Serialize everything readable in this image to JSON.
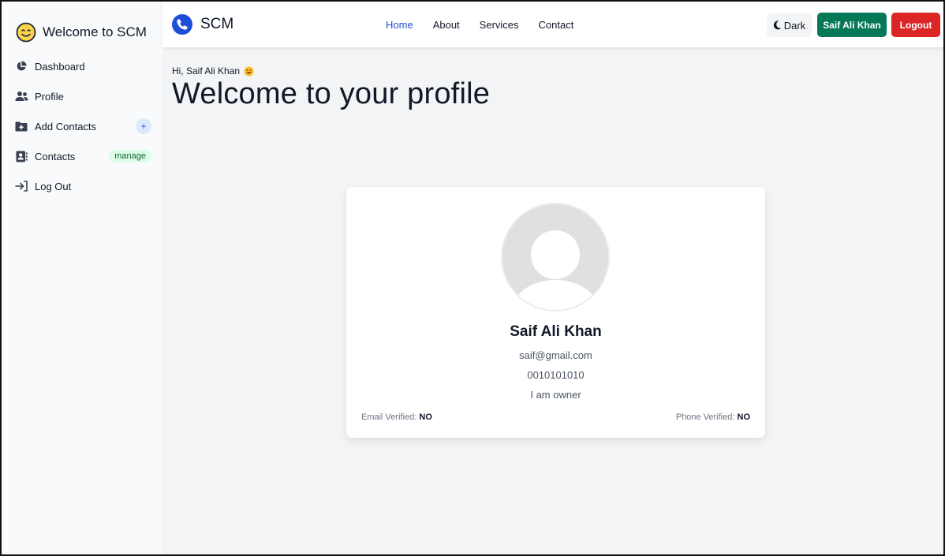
{
  "sidebar": {
    "brand": "Welcome to SCM",
    "items": [
      {
        "label": "Dashboard",
        "icon": "chart-pie-icon"
      },
      {
        "label": "Profile",
        "icon": "users-icon"
      },
      {
        "label": "Add Contacts",
        "icon": "folder-plus-icon",
        "badge": "+"
      },
      {
        "label": "Contacts",
        "icon": "address-book-icon",
        "badge": "manage"
      },
      {
        "label": "Log Out",
        "icon": "sign-out-icon"
      }
    ]
  },
  "navbar": {
    "logo_text": "SCM",
    "links": [
      "Home",
      "About",
      "Services",
      "Contact"
    ],
    "active_link": "Home",
    "dark_label": "Dark",
    "user_label": "Saif Ali Khan",
    "logout_label": "Logout"
  },
  "main": {
    "greeting": "Hi, Saif Ali Khan",
    "title": "Welcome to your profile"
  },
  "profile": {
    "name": "Saif Ali Khan",
    "email": "saif@gmail.com",
    "phone": "0010101010",
    "about": "I am owner",
    "email_verified_label": "Email Verified:",
    "email_verified_value": "NO",
    "phone_verified_label": "Phone Verified:",
    "phone_verified_value": "NO"
  },
  "colors": {
    "accent_blue": "#1d4ed8",
    "user_button": "#047857",
    "logout_button": "#dc2626"
  }
}
